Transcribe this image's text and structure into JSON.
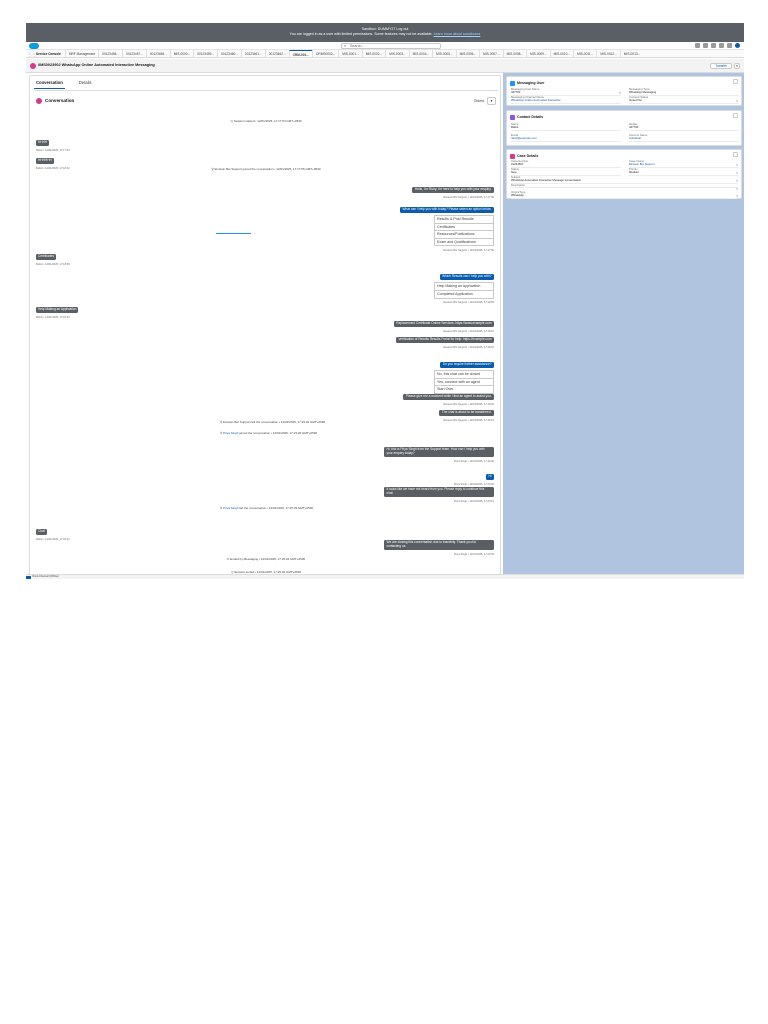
{
  "banner": {
    "line1": "Sandbox: DUMMY27     Log out",
    "line2": "You are logged in as a user with limited permissions. Some features may not be available.",
    "link": "Learn more about sandboxes"
  },
  "header": {
    "search_placeholder": "Search..."
  },
  "app_name": "Service Console",
  "tabs": [
    "MRF Management",
    "00123456...",
    "00123457...",
    "00123458...",
    "MIS-0000...",
    "00123459...",
    "00123460...",
    "00123461...",
    "00123462...",
    "CRM-001...",
    "ORMS0002...",
    "MIS-0001...",
    "MIS-0002...",
    "MIS-0003...",
    "MIS-0004...",
    "MIS-0005...",
    "MIS-0006...",
    "MIS-0007...",
    "MIS-0008...",
    "MIS-0009...",
    "MIS-0010...",
    "MIS-0011...",
    "MIS-0012...",
    "MIS-0013..."
  ],
  "record": {
    "title": "0MS0023902 WhatsApp Online Automated Interactive Messaging",
    "button": "Transfer"
  },
  "panel": {
    "tab_conversation": "Conversation",
    "tab_details": "Details",
    "conversation_title": "Conversation",
    "sort_label": "Oldest"
  },
  "timeline": {
    "session_started": "Session started • 12/01/2025, 17:17:54 GMT+0530",
    "joined_1": "Einstein Bot Support joined the conversation • 12/01/2025, 17:17:55 GMT+0530",
    "left_bot": "Einstein Bot Support left the conversation • 12/01/2025, 17:19:22 GMT+0530",
    "agent_name": "Priya Singh",
    "agent_joined_text": " joined the conversation • 12/01/2025, 17:19:26 GMT+0530",
    "agent_left_text": " left the conversation • 12/01/2025, 17:25:03 GMT+0530",
    "ended_by": "Ended by Messaging • 12/01/2025, 17:25:04 GMT+0530",
    "session_ended": "Session ended • 12/01/2025, 17:25:04 GMT+0530"
  },
  "messages": {
    "in_hi1": "HHHH",
    "in_hi1_meta": "Rahul • 12/01/2025, 17:17:54",
    "in_hi2": "HHHHHH",
    "in_hi2_meta": "Rahul • 12/01/2025, 17:18:02",
    "out_hello": "Hello, I'm Ruby, I'm here to help you with your enquiry.",
    "out_hello_meta": "Einstein Bot Support • 12/01/2025, 17:17:56",
    "out_menu": "What can I help you with today? Please select an option below.",
    "menu_options": [
      "Results & Post Results",
      "Certificates",
      "Resources/Publications",
      "Exam and Qualifications"
    ],
    "out_menu_meta": "Einstein Bot Support • 12/01/2025, 17:17:56",
    "in_cert": "Certificates",
    "in_cert_meta": "Rahul • 12/01/2025, 17:18:08",
    "out_cert_q": "Which Results can I help you with?",
    "cert_options": [
      "Help Making an Application",
      "Completed Application"
    ],
    "out_cert_meta": "Einstein Bot Support • 12/01/2025, 17:18:09",
    "in_help": "Help Making an Application",
    "in_help_meta": "Rahul • 12/01/2025, 17:18:20",
    "out_replace": "Replacement Certificate Online Services: https://www.example.com",
    "out_replace_meta": "Einstein Bot Support • 12/01/2025, 17:18:21",
    "out_verify": "Verification of Results Results Portal for help: https://example.com",
    "out_verify_meta": "Einstein Bot Support • 12/01/2025, 17:18:22",
    "out_more_q": "Do you require further assistance?",
    "more_options": [
      "No, this chat can be closed",
      "Yes, connect with an agent",
      "Start Over"
    ],
    "out_wait": "Please give me a moment while I find an agent to assist you.",
    "out_wait_meta": "Einstein Bot Support • 12/01/2025, 17:19:20",
    "out_wait2": "The chat is about to be transferred.",
    "out_wait2_meta": "Einstein Bot Support • 12/01/2025, 17:19:21",
    "out_agent_hi": "Hi, this is Priya Singh from the Support team. How can I help you with your enquiry today?",
    "out_agent_hi_meta": "Priya Singh • 12/01/2025, 17:19:40",
    "out_agent_small": "Hi",
    "out_agent_small_meta": "Priya Singh • 12/01/2025, 17:20:02",
    "out_agent_delay": "It looks like we have not heard from you. Please reply to continue this chat.",
    "out_agent_delay_meta": "Priya Singh • 12/01/2025, 17:23:10",
    "in_chat": "Chat",
    "in_chat_meta": "Rahul • 12/01/2025, 17:24:10",
    "out_close": "We are closing this conversation due to inactivity. Thank you for contacting us.",
    "out_close_meta": "Priya Singh • 12/01/2025, 17:24:59"
  },
  "cards": {
    "messaging_user": {
      "title": "Messaging User",
      "f1_label": "Messaging User Name",
      "f1_value": "447700",
      "f2_label": "Messaging Type",
      "f2_value": "WhatsApp Messaging",
      "f3_label": "Messaging Channel Name",
      "f3_value": "WhatsApp Online Automated Interactive",
      "f4_label": "Consent Status",
      "f4_value": "Opted Out"
    },
    "contact": {
      "title": "Contact Details",
      "f1_label": "Name",
      "f1_value": "Rahul",
      "f2_label": "Mobile",
      "f2_value": "447700",
      "f3_label": "Email",
      "f3_value": "rahul@example.com",
      "f4_label": "Account Name",
      "f4_value": "Individual"
    },
    "case": {
      "title": "Case Details",
      "f1_label": "Case Number",
      "f1_value": "01234567",
      "f2_label": "Case Owner",
      "f2_value": "Einstein Bot Support",
      "f3_label": "Status",
      "f3_value": "New",
      "f4_label": "Priority",
      "f4_value": "Medium",
      "f5_label": "Subject",
      "f5_value": "WhatsApp Automated Interactive Message Conversation",
      "f6_label": "Description",
      "f6_value": "",
      "f7_label": "Origin/Type",
      "f7_value": "WhatsApp"
    }
  },
  "footer": {
    "label": "Omni-Channel (Offline)"
  }
}
